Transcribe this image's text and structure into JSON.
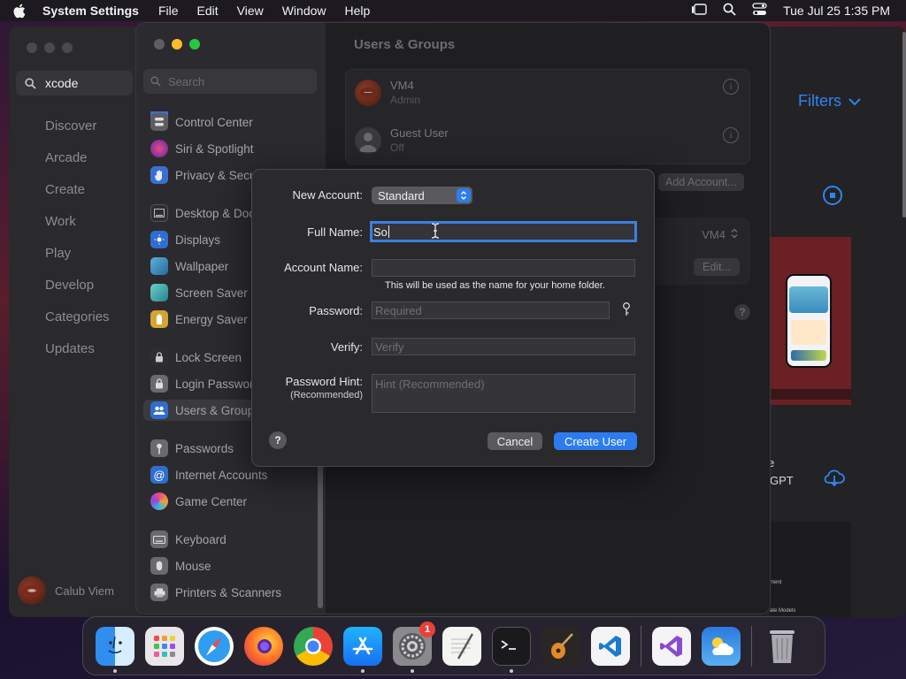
{
  "menubar": {
    "app_name": "System Settings",
    "menus": [
      "File",
      "Edit",
      "View",
      "Window",
      "Help"
    ],
    "clock": "Tue Jul 25  1:35 PM"
  },
  "appstore": {
    "search_value": "xcode",
    "nav": [
      "Discover",
      "Arcade",
      "Create",
      "Work",
      "Play",
      "Develop",
      "Categories",
      "Updates"
    ],
    "user_name": "Calub Viem",
    "filters_label": "Filters",
    "partial_text_1": "e",
    "partial_text_2": "GPT",
    "card_caption_1": "ment",
    "card_caption_2": "ate Models"
  },
  "settings": {
    "search_placeholder": "Search",
    "sidebar": {
      "items": [
        {
          "label": "Control Center",
          "icon": "control-center-icon",
          "color": "#5e5d62"
        },
        {
          "label": "Siri & Spotlight",
          "icon": "siri-icon",
          "color": "#b23a8a"
        },
        {
          "label": "Privacy & Security",
          "icon": "hand-icon",
          "color": "#3a6fd0"
        },
        {
          "label": "Desktop & Dock",
          "icon": "desktop-icon",
          "color": "#2e2d31"
        },
        {
          "label": "Displays",
          "icon": "sun-icon",
          "color": "#2f6dd0"
        },
        {
          "label": "Wallpaper",
          "icon": "wallpaper-icon",
          "color": "#3a8fb8"
        },
        {
          "label": "Screen Saver",
          "icon": "screen-saver-icon",
          "color": "#3aa0b0"
        },
        {
          "label": "Energy Saver",
          "icon": "battery-icon",
          "color": "#d2a630"
        },
        {
          "label": "Lock Screen",
          "icon": "lock-icon",
          "color": "#2e2d31"
        },
        {
          "label": "Login Password",
          "icon": "padlock-icon",
          "color": "#8a898e"
        },
        {
          "label": "Users & Groups",
          "icon": "users-icon",
          "color": "#2f6dd0"
        },
        {
          "label": "Passwords",
          "icon": "key-icon",
          "color": "#8a898e"
        },
        {
          "label": "Internet Accounts",
          "icon": "at-icon",
          "color": "#2f6dd0"
        },
        {
          "label": "Game Center",
          "icon": "game-center-icon",
          "color": "#d05a9a"
        },
        {
          "label": "Keyboard",
          "icon": "keyboard-icon",
          "color": "#8a898e"
        },
        {
          "label": "Mouse",
          "icon": "mouse-icon",
          "color": "#8a898e"
        },
        {
          "label": "Printers & Scanners",
          "icon": "printer-icon",
          "color": "#8a898e"
        }
      ]
    },
    "page_title": "Users & Groups",
    "users": [
      {
        "name": "VM4",
        "role": "Admin"
      },
      {
        "name": "Guest User",
        "role": "Off"
      }
    ],
    "add_account_label": "Add Account...",
    "auto_login_value": "VM4",
    "edit_label": "Edit..."
  },
  "dialog": {
    "new_account_label": "New Account:",
    "new_account_value": "Standard",
    "full_name_label": "Full Name:",
    "full_name_value": "So",
    "account_name_label": "Account Name:",
    "account_name_value": "",
    "home_folder_note": "This will be used as the name for your home folder.",
    "password_label": "Password:",
    "password_placeholder": "Required",
    "verify_label": "Verify:",
    "verify_placeholder": "Verify",
    "hint_label": "Password Hint:",
    "hint_sublabel": "(Recommended)",
    "hint_placeholder": "Hint (Recommended)",
    "cancel_label": "Cancel",
    "create_label": "Create User"
  },
  "dock": {
    "apps": [
      {
        "name": "Finder",
        "icon": "finder-icon",
        "running": true
      },
      {
        "name": "Launchpad",
        "icon": "launchpad-icon",
        "running": false
      },
      {
        "name": "Safari",
        "icon": "safari-icon",
        "running": false
      },
      {
        "name": "Firefox",
        "icon": "firefox-icon",
        "running": false
      },
      {
        "name": "Chrome",
        "icon": "chrome-icon",
        "running": false
      },
      {
        "name": "App Store",
        "icon": "app-store-icon",
        "running": true
      },
      {
        "name": "System Settings",
        "icon": "system-settings-icon",
        "running": true,
        "badge": "1"
      },
      {
        "name": "TextEdit",
        "icon": "textedit-icon",
        "running": false
      },
      {
        "name": "Terminal",
        "icon": "terminal-icon",
        "running": true
      },
      {
        "name": "GarageBand",
        "icon": "garageband-icon",
        "running": false
      },
      {
        "name": "VS Code",
        "icon": "vscode-icon",
        "running": false
      },
      {
        "name": "Visual Studio",
        "icon": "visual-studio-icon",
        "running": false
      },
      {
        "name": "Weather",
        "icon": "weather-icon",
        "running": false
      },
      {
        "name": "Trash",
        "icon": "trash-icon",
        "running": false
      }
    ]
  },
  "colors": {
    "accent": "#2c7cf0",
    "badge": "#e8413a",
    "close": "#ff5f57",
    "minimize": "#febc2e",
    "zoom": "#28c840"
  }
}
